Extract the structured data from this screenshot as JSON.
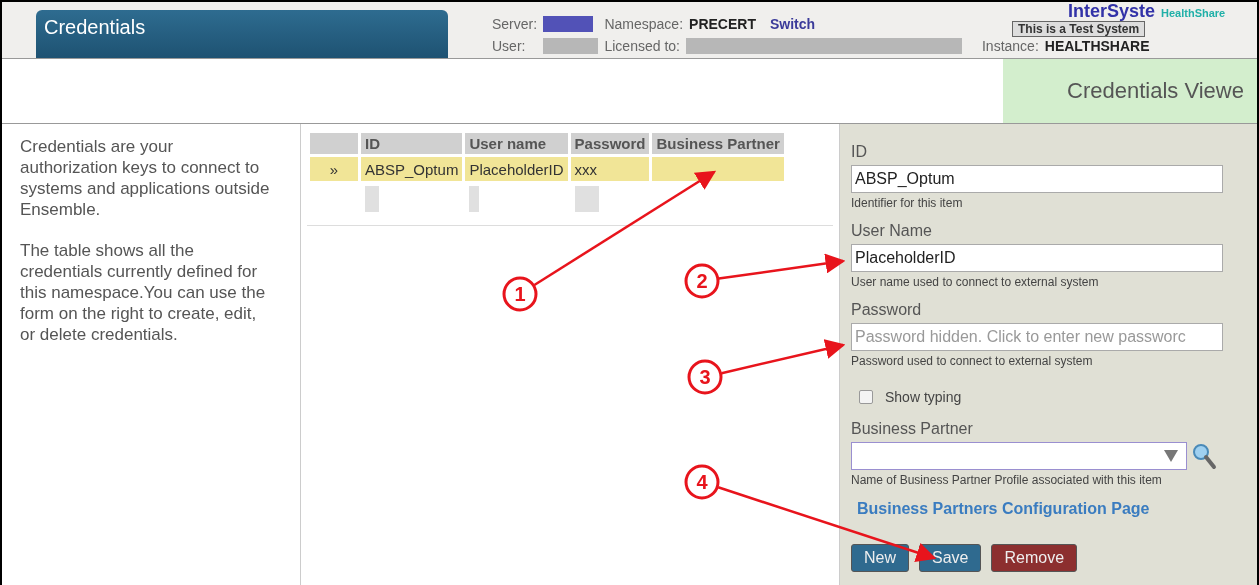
{
  "header": {
    "title": "Credentials",
    "server_label": "Server:",
    "user_label": "User:",
    "namespace_label": "Namespace:",
    "namespace": "PRECERT",
    "switch_link": "Switch",
    "licensed_label": "Licensed to:",
    "instance_label": "Instance:",
    "instance": "HEALTHSHARE",
    "banner": "This is a Test System",
    "logo": {
      "name": "InterSyste",
      "product": "HealthShare"
    }
  },
  "subheader": {
    "panel_title": "Credentials Viewe"
  },
  "description": [
    "Credentials are your authorization keys to connect to systems and applications outside Ensemble.",
    "The table shows all the credentials currently defined for this namespace.You can use the form on the right to create, edit, or delete credentials."
  ],
  "table": {
    "columns": [
      "ID",
      "User name",
      "Password",
      "Business Partner"
    ],
    "rows": [
      {
        "kind": "record",
        "selected": true,
        "marker": "»",
        "cells": [
          "ABSP_Optum",
          "PlaceholderID",
          "xxx"
        ]
      },
      {
        "kind": "redacted",
        "selected": false
      }
    ]
  },
  "form": {
    "fields": [
      {
        "kind": "text",
        "label": "ID",
        "value": "ABSP_Optum",
        "hint": "Identifier for this item"
      },
      {
        "kind": "text",
        "label": "User Name",
        "value": "PlaceholderID",
        "hint": "User name used to connect to external system"
      },
      {
        "kind": "password",
        "label": "Password",
        "placeholder": "Password hidden. Click to enter new passworc",
        "hint": "Password used to connect to external system"
      },
      {
        "kind": "checkbox",
        "label": "Show typing",
        "checked": false
      },
      {
        "kind": "select",
        "label": "Business Partner",
        "hint": "Name of Business Partner Profile associated with this item"
      }
    ],
    "link": "Business Partners Configuration Page",
    "buttons": [
      {
        "label": "New",
        "color": "#2f6a8f"
      },
      {
        "label": "Save",
        "color": "#2f6a8f"
      },
      {
        "label": "Remove",
        "color": "#8c2f2f"
      }
    ]
  },
  "annotations": [
    {
      "label": "1"
    },
    {
      "label": "2"
    },
    {
      "label": "3"
    },
    {
      "label": "4"
    }
  ]
}
